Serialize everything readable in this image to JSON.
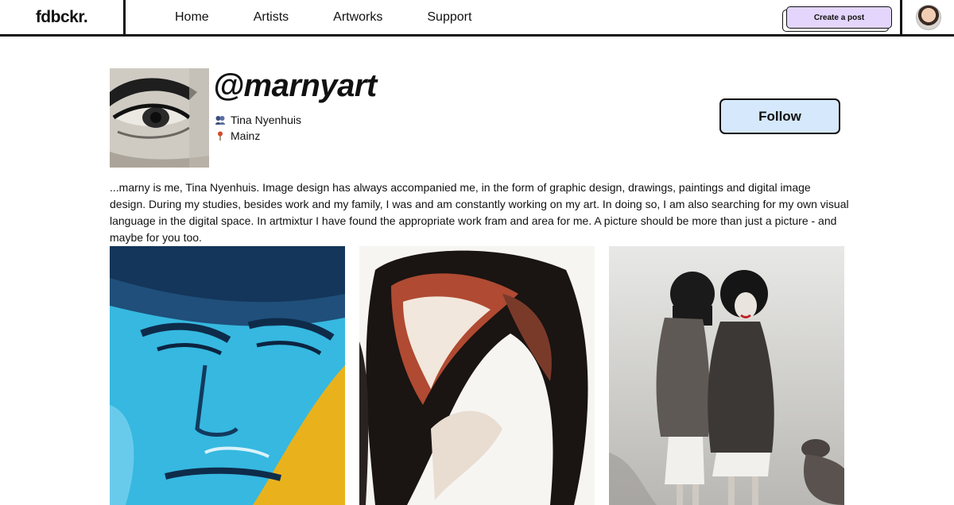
{
  "nav": {
    "logo": "fdbckr.",
    "links": [
      "Home",
      "Artists",
      "Artworks",
      "Support"
    ],
    "create_label": "Create a post"
  },
  "profile": {
    "handle": "@marnyart",
    "name": "Tina Nyenhuis",
    "location": "Mainz",
    "follow_label": "Follow",
    "bio": "...marny is me, Tina Nyenhuis. Image design has always accompanied me, in the form of graphic design, drawings, paintings and digital image design. During my studies, besides work and my family, I was and am constantly working on my art. In doing so, I am also searching for my own visual language in the digital space. In artmixtur I have found the appropriate work fram and area for me. A picture should be more than just a picture - and maybe for you too."
  },
  "icons": {
    "name": "people-icon",
    "location": "map-pin-icon"
  },
  "colors": {
    "create_bg": "#e3d5fb",
    "follow_bg": "#d6e8fb",
    "border": "#111111"
  }
}
